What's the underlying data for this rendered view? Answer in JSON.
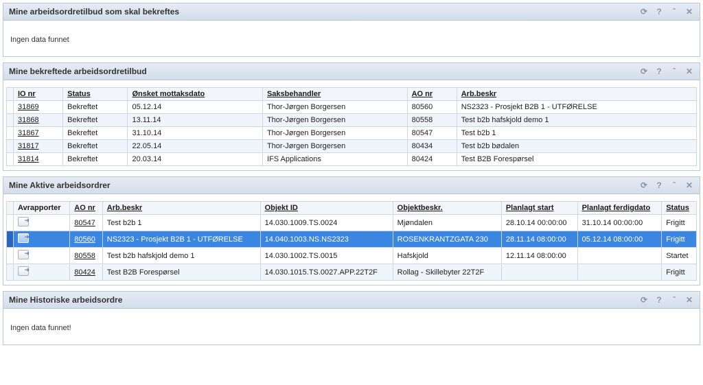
{
  "portlets": {
    "p1": {
      "title": "Mine arbeidsordretilbud som skal bekreftes",
      "empty": "Ingen data funnet"
    },
    "p2": {
      "title": "Mine bekreftede arbeidsordretilbud",
      "columns": [
        "IO nr",
        "Status",
        "Ønsket mottaksdato",
        "Saksbehandler",
        "AO nr",
        "Arb.beskr"
      ],
      "rows": [
        {
          "io": "31869",
          "status": "Bekreftet",
          "dato": "05.12.14",
          "saks": "Thor-Jørgen Borgersen",
          "ao": "80560",
          "beskr": "NS2323 - Prosjekt B2B 1 - UTFØRELSE"
        },
        {
          "io": "31868",
          "status": "Bekreftet",
          "dato": "13.11.14",
          "saks": "Thor-Jørgen Borgersen",
          "ao": "80558",
          "beskr": "Test b2b hafskjold demo 1"
        },
        {
          "io": "31867",
          "status": "Bekreftet",
          "dato": "31.10.14",
          "saks": "Thor-Jørgen Borgersen",
          "ao": "80547",
          "beskr": "Test b2b 1"
        },
        {
          "io": "31817",
          "status": "Bekreftet",
          "dato": "22.05.14",
          "saks": "Thor-Jørgen Borgersen",
          "ao": "80434",
          "beskr": "Test b2b bødalen"
        },
        {
          "io": "31814",
          "status": "Bekreftet",
          "dato": "20.03.14",
          "saks": "IFS Applications",
          "ao": "80424",
          "beskr": "Test B2B Forespørsel"
        }
      ]
    },
    "p3": {
      "title": "Mine Aktive arbeidsordrer",
      "columns": [
        "Avrapporter",
        "AO nr",
        "Arb.beskr",
        "Objekt ID",
        "Objektbeskr.",
        "Planlagt start",
        "Planlagt ferdigdato",
        "Status"
      ],
      "rows": [
        {
          "ao": "80547",
          "beskr": "Test b2b 1",
          "obj": "14.030.1009.TS.0024",
          "objb": "Mjøndalen",
          "start": "28.10.14 00:00:00",
          "slutt": "31.10.14 00:00:00",
          "status": "Frigitt",
          "selected": false
        },
        {
          "ao": "80560",
          "beskr": "NS2323 - Prosjekt B2B 1 - UTFØRELSE",
          "obj": "14.040.1003.NS.NS2323",
          "objb": "ROSENKRANTZGATA 230",
          "start": "28.11.14 08:00:00",
          "slutt": "05.12.14 08:00:00",
          "status": "Frigitt",
          "selected": true
        },
        {
          "ao": "80558",
          "beskr": "Test b2b hafskjold demo 1",
          "obj": "14.030.1002.TS.0015",
          "objb": "Hafskjold",
          "start": "12.11.14 08:00:00",
          "slutt": "",
          "status": "Startet",
          "selected": false
        },
        {
          "ao": "80424",
          "beskr": "Test B2B Forespørsel",
          "obj": "14.030.1015.TS.0027.APP.22T2F",
          "objb": "Rollag - Skillebyter 22T2F",
          "start": "",
          "slutt": "",
          "status": "Frigitt",
          "selected": false
        }
      ]
    },
    "p4": {
      "title": "Mine Historiske arbeidsordre",
      "empty": "Ingen data funnet!"
    }
  },
  "icons": {
    "refresh": "⟳",
    "help": "?",
    "collapse": "ˆ",
    "close": "✕"
  }
}
